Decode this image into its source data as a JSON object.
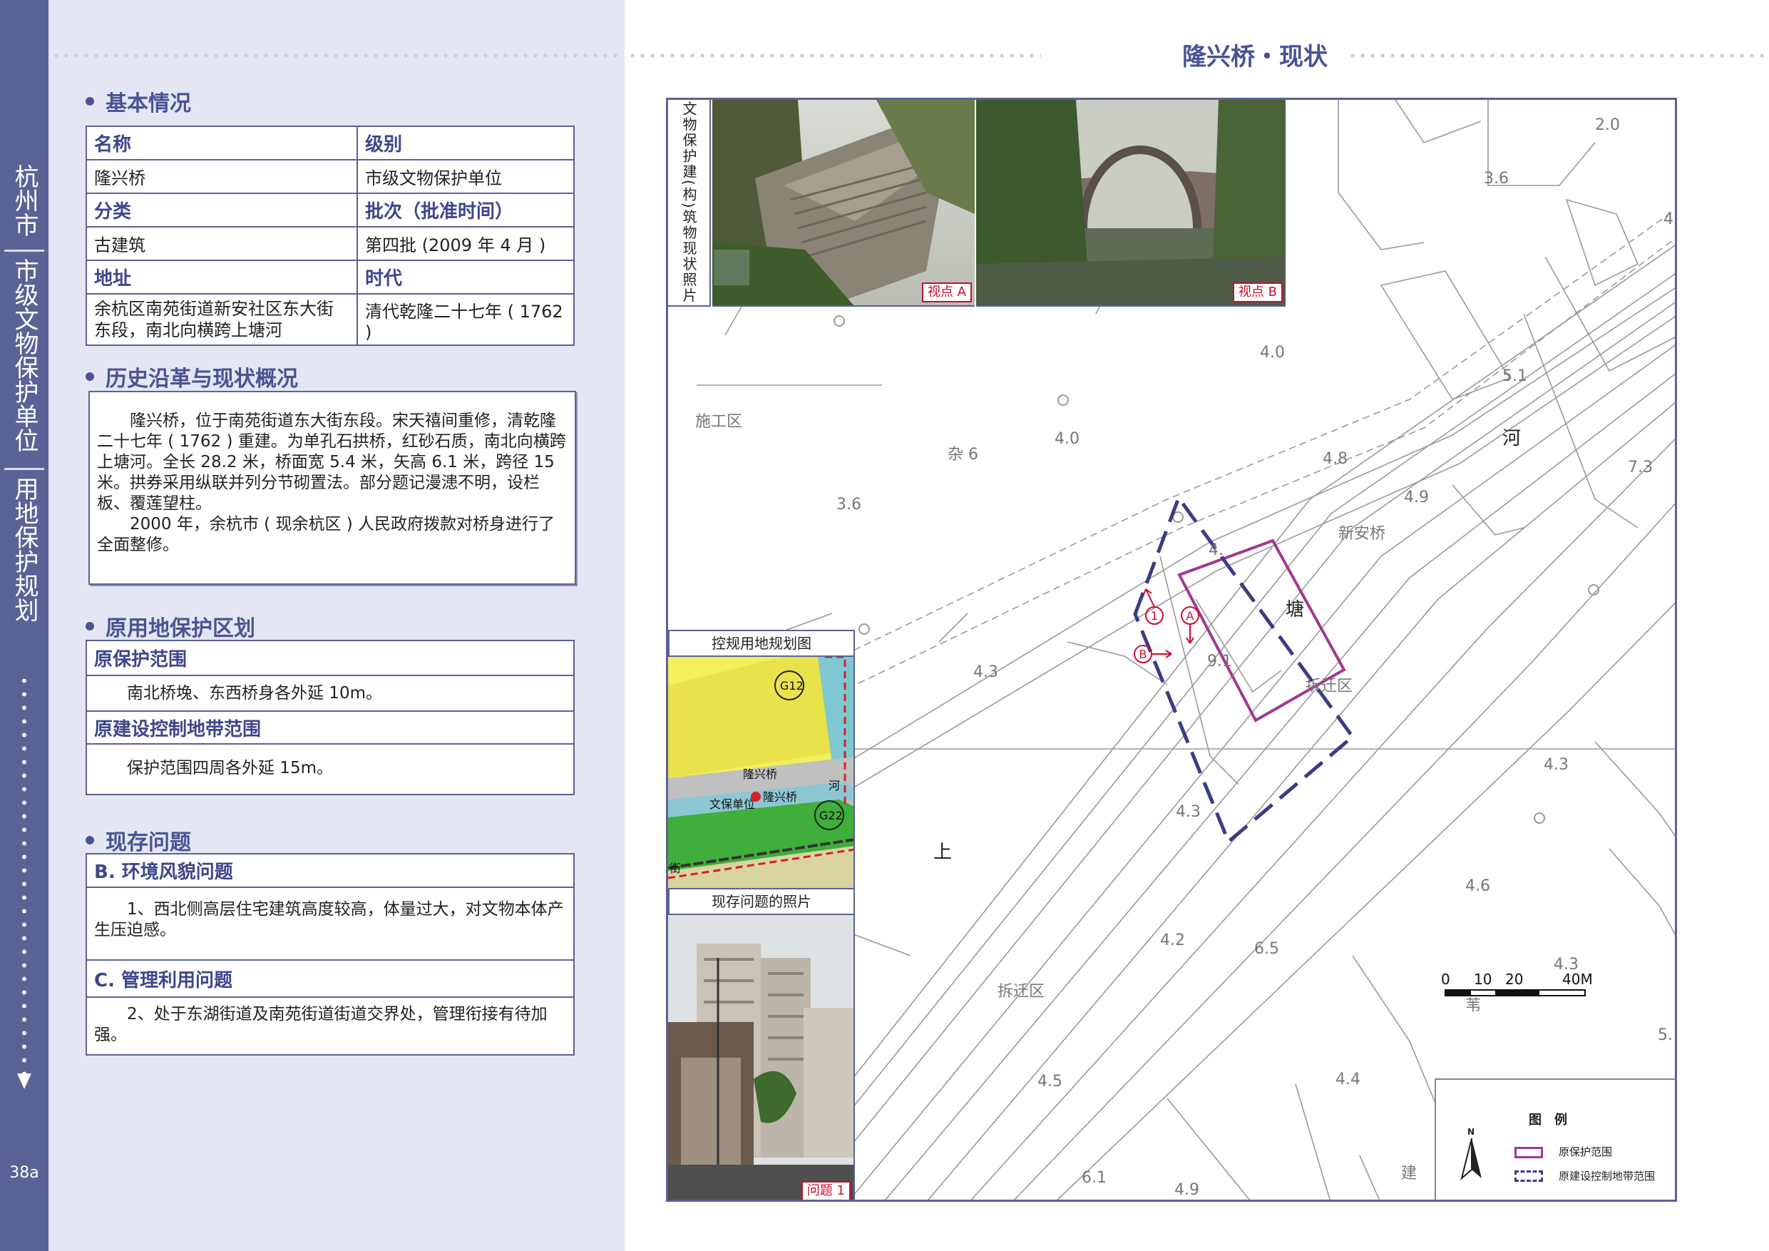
{
  "sidebar": {
    "city": "杭州市",
    "category": "市级文物保护单位",
    "section": "用地保护规划",
    "page_number": "38a"
  },
  "page_title": "隆兴桥・现状",
  "basic_info": {
    "heading": "基本情况",
    "name_label": "名称",
    "name_value": "隆兴桥",
    "level_label": "级别",
    "level_value": "市级文物保护单位",
    "type_label": "分类",
    "type_value": "古建筑",
    "batch_label": "批次（批准时间）",
    "batch_value": "第四批 (2009 年 4 月 )",
    "address_label": "地址",
    "address_value": "余杭区南苑街道新安社区东大街东段，南北向横跨上塘河",
    "era_label": "时代",
    "era_value": "清代乾隆二十七年 ( 1762 )"
  },
  "history": {
    "heading": "历史沿革与现状概况",
    "para1": "隆兴桥，位于南苑街道东大街东段。宋天禧间重修，清乾隆二十七年 ( 1762 ) 重建。为单孔石拱桥，红砂石质，南北向横跨上塘河。全长 28.2 米，桥面宽 5.4 米，矢高 6.1 米，跨径 15 米。拱券采用纵联并列分节砌置法。部分题记漫漶不明，设栏板、覆莲望柱。",
    "para2": "2000 年，余杭市 ( 现余杭区 ) 人民政府拨款对桥身进行了全面整修。"
  },
  "protection": {
    "heading": "原用地保护区划",
    "range_title": "原保护范围",
    "range_text": "南北桥堍、东西桥身各外延 10m。",
    "control_title": "原建设控制地带范围",
    "control_text": "保护范围四周各外延 15m。"
  },
  "problems": {
    "heading": "现存问题",
    "b_title": "B. 环境风貌问题",
    "b_text": "1、西北侧高层住宅建筑高度较高，体量过大，对文物本体产生压迫感。",
    "c_title": "C. 管理利用问题",
    "c_text": "2、处于东湖街道及南苑街道街道交界处，管理衔接有待加强。"
  },
  "map": {
    "photo_strip_label": "文物保护建(构)筑物现状照片",
    "view_a": "视点 A",
    "view_b": "视点 B",
    "plan_caption": "控规用地规划图",
    "plan_labels": {
      "g12": "G12",
      "g22": "G22",
      "bridge": "隆兴桥",
      "unit": "文保单位",
      "unit2": "隆兴桥",
      "river": "河",
      "street": "街"
    },
    "problem_caption": "现存问题的照片",
    "problem_photo_label": "问题 1",
    "labels": {
      "construction": "施工区",
      "misc": "杂 6",
      "river": "河",
      "tang": "塘",
      "shang": "上",
      "xinan_bridge": "新安桥",
      "demolish1": "拆迁区",
      "demolish2": "拆迁区",
      "jian": "建",
      "shi": "苇"
    },
    "elevations": [
      "2.0",
      "3.6",
      "4.0",
      "5.1",
      "4.0",
      "4.8",
      "4.9",
      "7.3",
      "3.6",
      "4.",
      "4.3",
      "9.1",
      "4.3",
      "4.3",
      "4.6",
      "4.2",
      "6.5",
      "4.3",
      "4.5",
      "4.4",
      "6.1",
      "4.9",
      "5.",
      "4."
    ],
    "markers": {
      "m1": "1",
      "ma": "A",
      "mb": "B"
    },
    "scale": {
      "t0": "0",
      "t1": "10",
      "t2": "20",
      "t3": "40M"
    },
    "legend": {
      "title": "图　例",
      "north": "N",
      "item1": "原保护范围",
      "item2": "原建设控制地带范围"
    },
    "colors": {
      "protect": "#a0398f",
      "control": "#3a3d84",
      "marker": "#c8102e"
    }
  }
}
